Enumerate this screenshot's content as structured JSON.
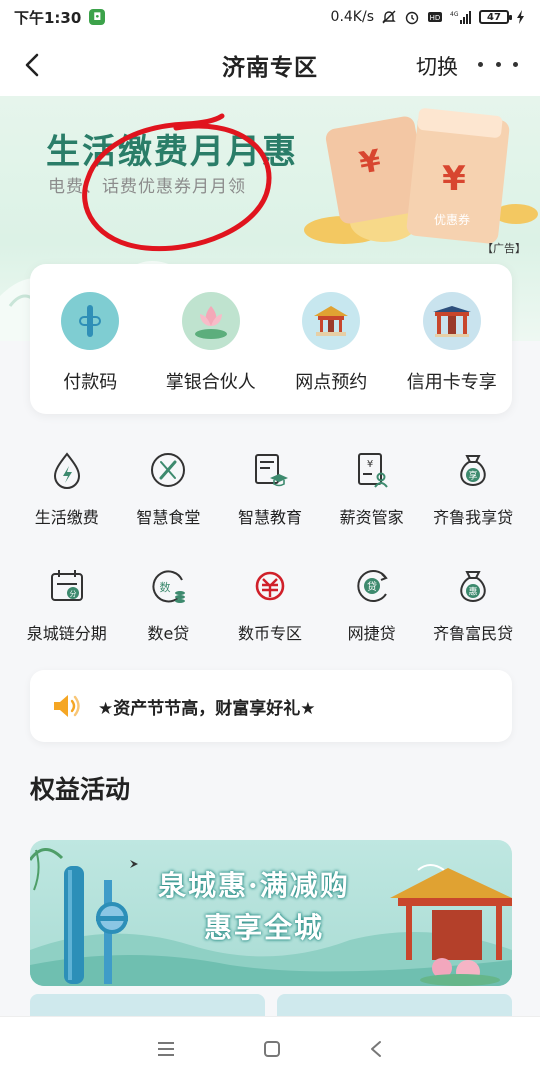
{
  "status_bar": {
    "time": "下午1:30",
    "network_speed": "0.4K/s",
    "battery_level": "47",
    "icons": [
      "app-badge-icon",
      "mute-icon",
      "alarm-icon",
      "hd-icon",
      "signal-4g-icon",
      "battery-icon",
      "charging-icon"
    ]
  },
  "nav": {
    "title": "济南专区",
    "switch_label": "切换",
    "back_icon": "chevron-left-icon",
    "more_icon": "more-dots-icon"
  },
  "banner": {
    "title": "生活缴费月月惠",
    "subtitle": "电费、话费优惠券月月领",
    "ad_tag": "【广告】",
    "coupon_text": "优惠券",
    "yen": "¥"
  },
  "quick_actions": [
    {
      "label": "付款码",
      "icon": "payment-code-icon"
    },
    {
      "label": "掌银合伙人",
      "icon": "lotus-partner-icon"
    },
    {
      "label": "网点预约",
      "icon": "pavilion-icon"
    },
    {
      "label": "信用卡专享",
      "icon": "gate-arch-icon"
    }
  ],
  "services": [
    {
      "label": "生活缴费",
      "icon": "drop-bolt-icon"
    },
    {
      "label": "智慧食堂",
      "icon": "utensils-icon"
    },
    {
      "label": "智慧教育",
      "icon": "graduation-doc-icon"
    },
    {
      "label": "薪资管家",
      "icon": "salary-doc-icon"
    },
    {
      "label": "齐鲁我享贷",
      "icon": "money-bag-icon",
      "glyph": "享"
    },
    {
      "label": "泉城链分期",
      "icon": "calendar-icon",
      "glyph": "分"
    },
    {
      "label": "数e贷",
      "icon": "coin-circle-icon",
      "glyph": "数"
    },
    {
      "label": "数币专区",
      "icon": "digital-yuan-icon"
    },
    {
      "label": "网捷贷",
      "icon": "loan-circle-icon",
      "glyph": "贷"
    },
    {
      "label": "齐鲁富民贷",
      "icon": "money-bag-icon",
      "glyph": "惠"
    }
  ],
  "notice": {
    "text": "★资产节节高，财富享好礼★",
    "icon": "speaker-icon"
  },
  "section": {
    "title": "权益活动"
  },
  "promo": {
    "line1": "泉城惠·满减购",
    "line2": "惠享全城"
  },
  "system_nav": {
    "icons": [
      "menu-icon",
      "home-square-icon",
      "back-triangle-icon"
    ]
  },
  "colors": {
    "brand_green": "#2a7d68",
    "icon_green": "#3d8a6e",
    "notice_orange": "#f5a623",
    "digital_red": "#d0202a",
    "annotation_red": "#e0141e"
  }
}
